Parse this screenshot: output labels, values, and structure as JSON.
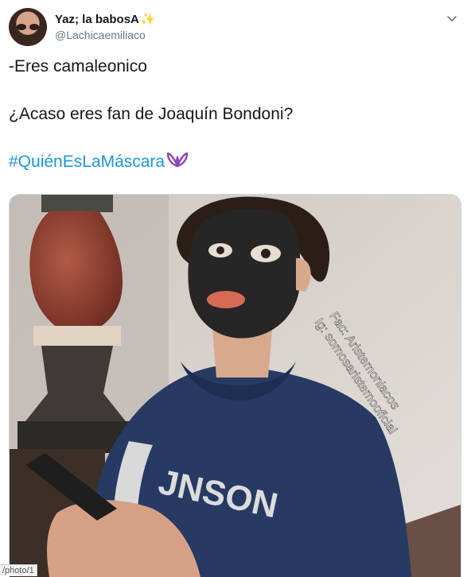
{
  "tweet": {
    "author": {
      "display_name": "Yaz; la babosA",
      "emoji": "✨",
      "handle": "@Lachicaemiliaco"
    },
    "lines": [
      "-Eres camaleonico",
      "¿Acaso eres fan de Joaquín Bondoni?"
    ],
    "hashtag": "#QuiénEsLaMáscara",
    "hashtag_emoji_icon": "purple-butterfly-icon",
    "menu_icon": "chevron-down-icon",
    "media": {
      "watermark_line_1": "Fac: Aristemoniacos",
      "watermark_line_2": "Ig: somosaristemooficial",
      "sweatshirt_text": "JNSON"
    }
  },
  "status_bar": {
    "url": "/photo/1"
  },
  "colors": {
    "link": "#1b95e0",
    "secondary_text": "#657786",
    "butterfly": "#8a43b8"
  }
}
